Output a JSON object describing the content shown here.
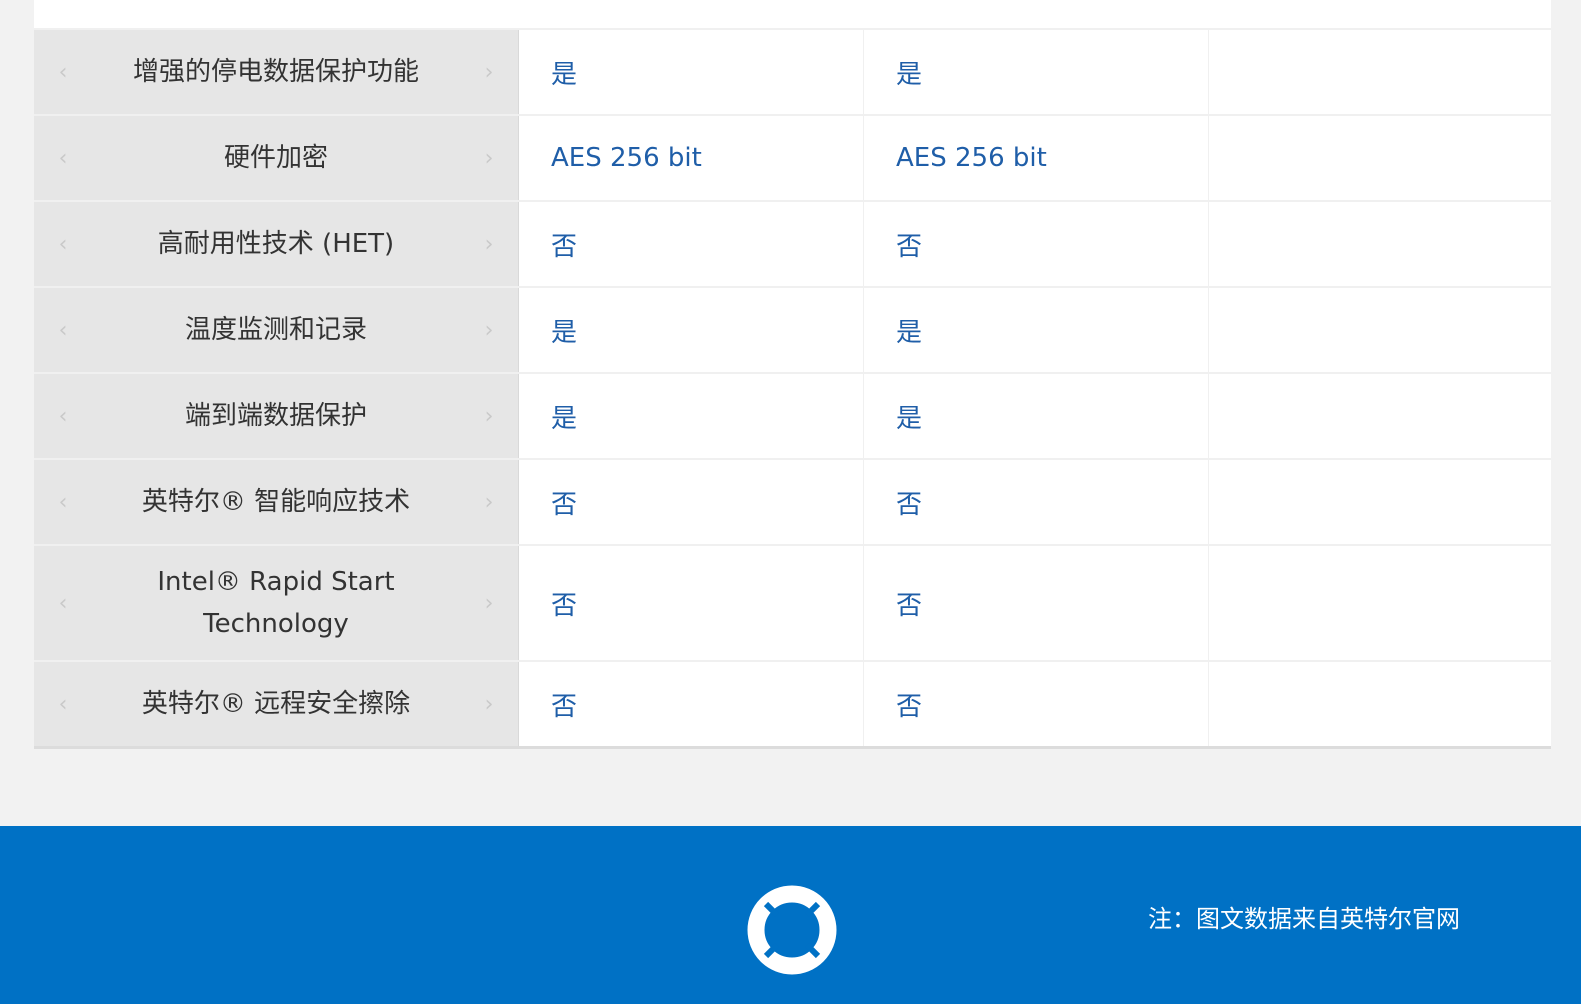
{
  "spec_table": {
    "rows": [
      {
        "label": "增强的停电数据保护功能",
        "values": [
          "是",
          "是",
          ""
        ]
      },
      {
        "label": "硬件加密",
        "values": [
          "AES 256 bit",
          "AES 256 bit",
          ""
        ]
      },
      {
        "label": "高耐用性技术 (HET)",
        "values": [
          "否",
          "否",
          ""
        ]
      },
      {
        "label": "温度监测和记录",
        "values": [
          "是",
          "是",
          ""
        ]
      },
      {
        "label": "端到端数据保护",
        "values": [
          "是",
          "是",
          ""
        ]
      },
      {
        "label": "英特尔® 智能响应技术",
        "values": [
          "否",
          "否",
          ""
        ]
      },
      {
        "label": "Intel® Rapid Start Technology",
        "values": [
          "否",
          "否",
          ""
        ]
      },
      {
        "label": "英特尔® 远程安全擦除",
        "values": [
          "否",
          "否",
          ""
        ]
      }
    ],
    "prev_glyph": "‹",
    "next_glyph": "›"
  },
  "footer": {
    "icon": "lifebuoy-icon",
    "note": "注：图文数据来自英特尔官网",
    "color": "#0071c5"
  }
}
